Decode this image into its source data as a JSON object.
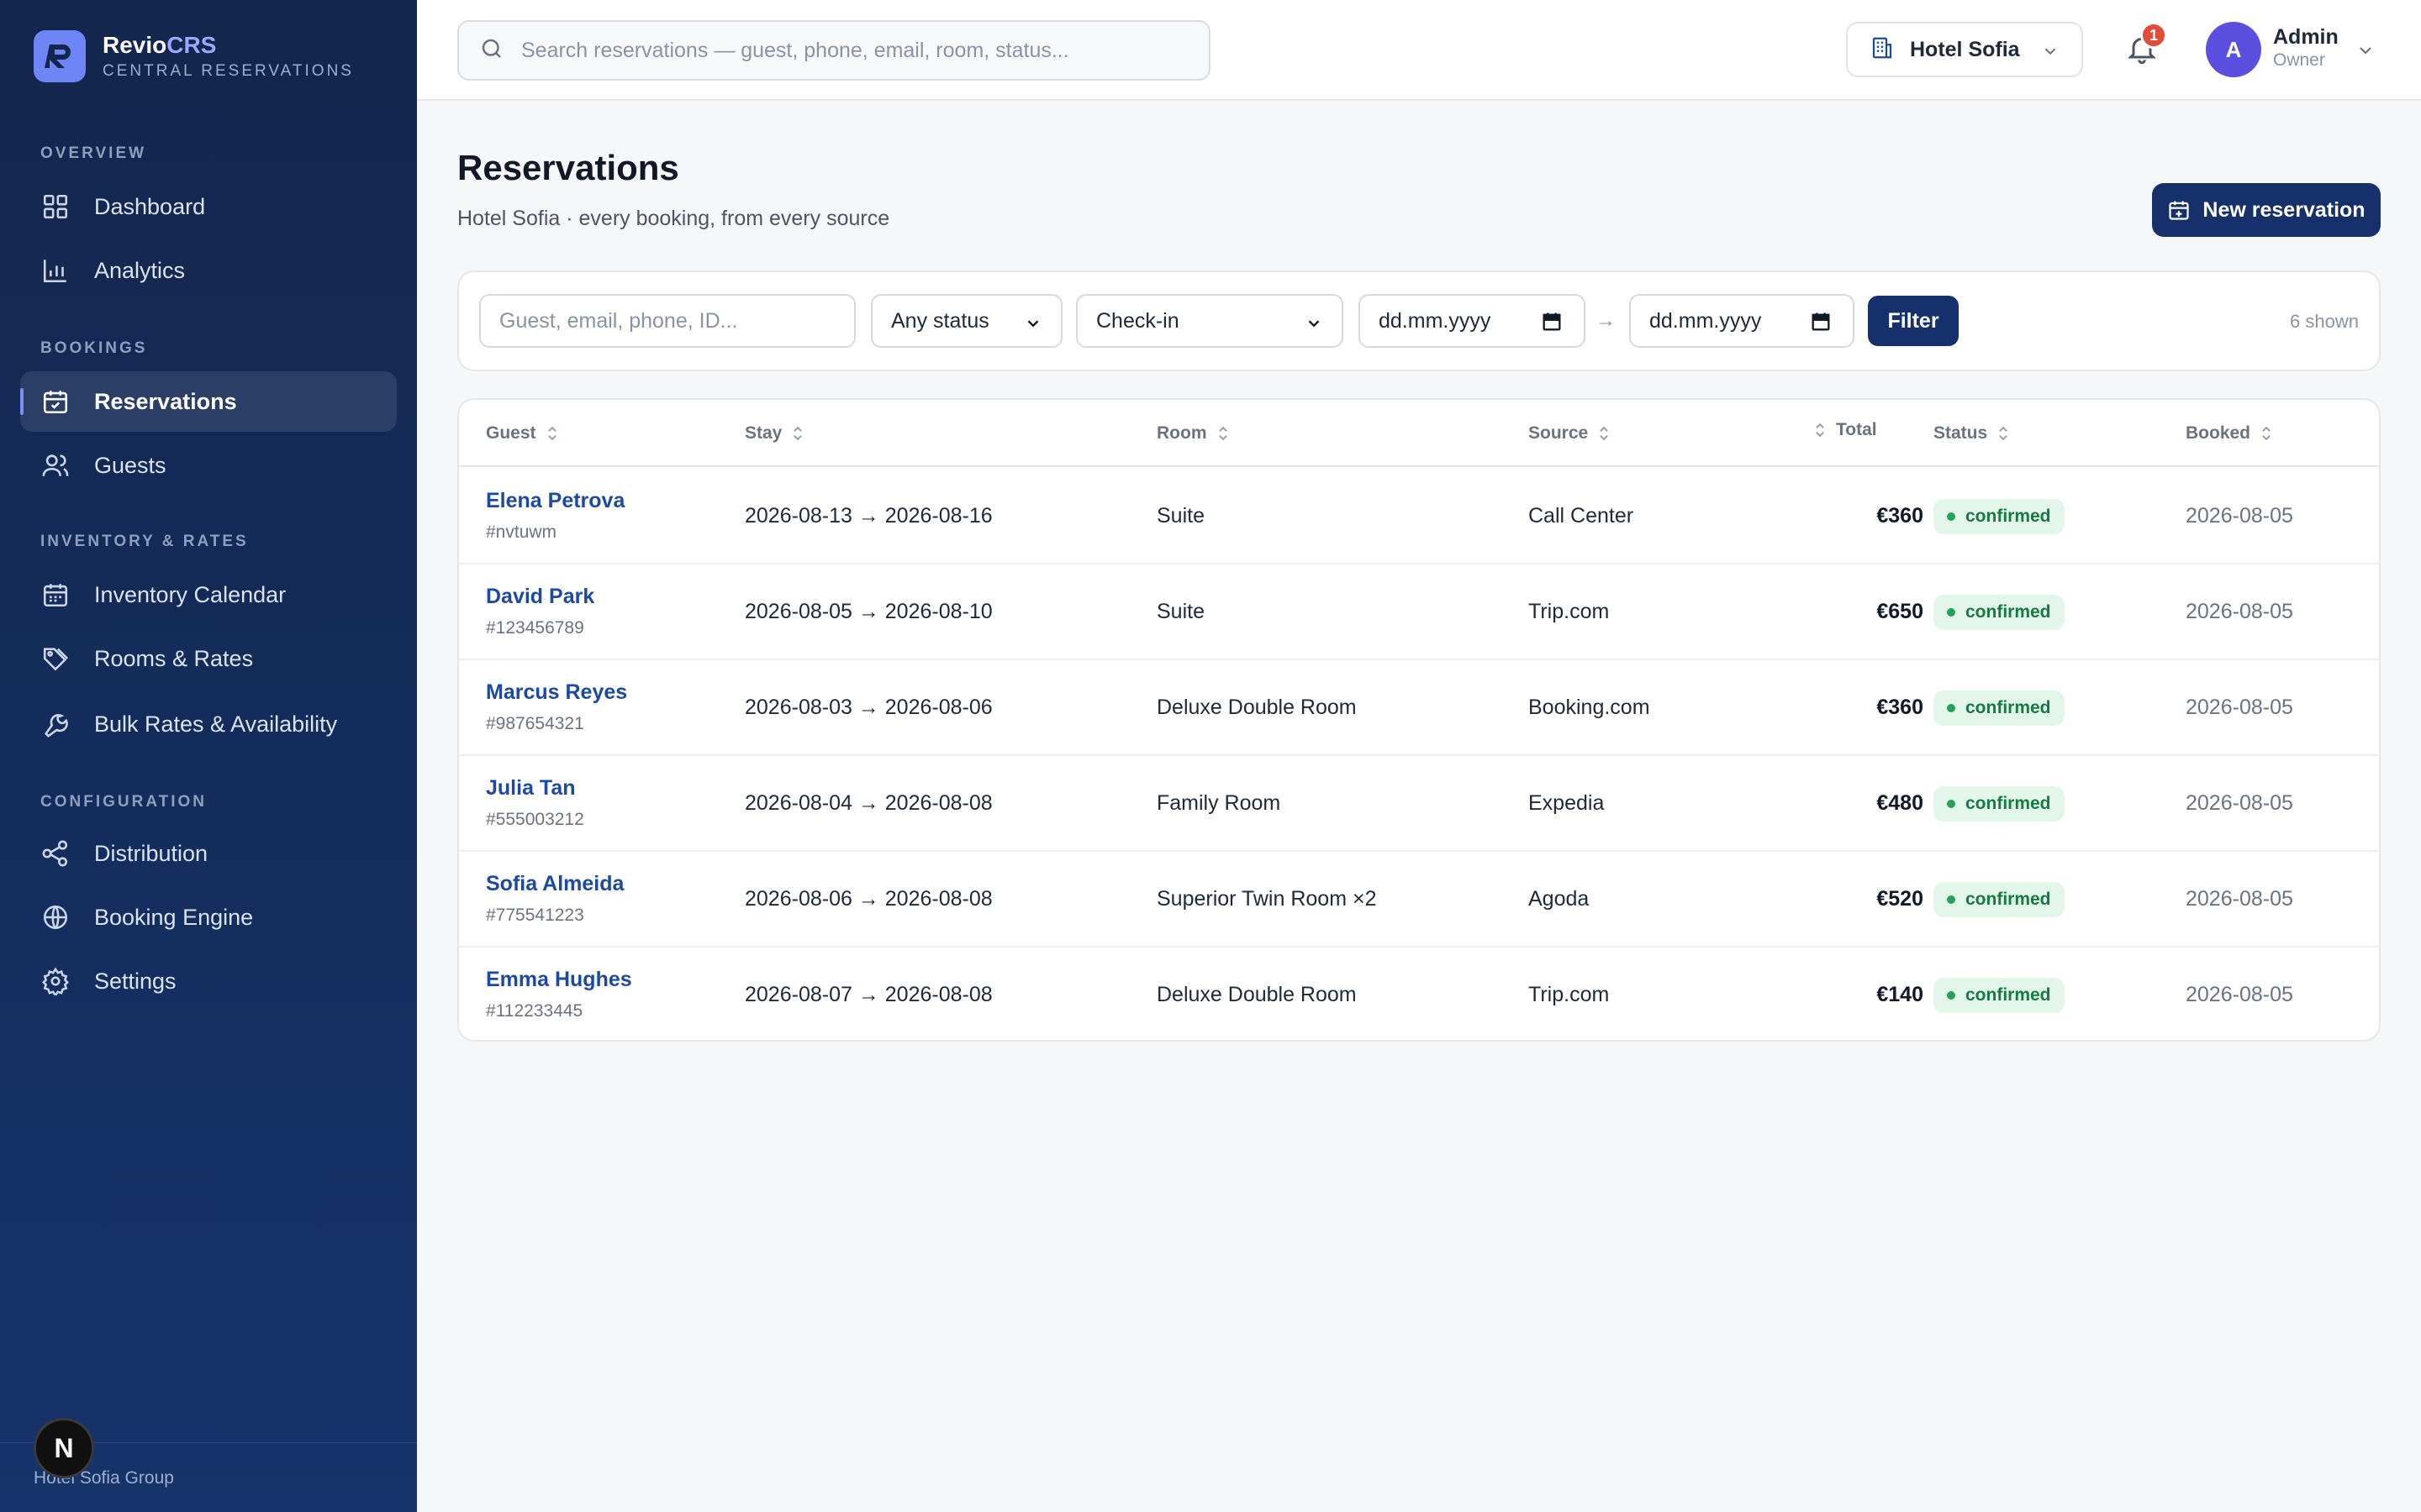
{
  "brand": {
    "name_main": "Revio",
    "name_accent": "CRS",
    "subtitle": "CENTRAL RESERVATIONS"
  },
  "sidebar": {
    "sections": [
      {
        "label": "OVERVIEW",
        "items": [
          {
            "label": "Dashboard",
            "icon": "grid-icon"
          },
          {
            "label": "Analytics",
            "icon": "bar-chart-icon"
          }
        ]
      },
      {
        "label": "BOOKINGS",
        "items": [
          {
            "label": "Reservations",
            "icon": "calendar-check-icon",
            "active": true
          },
          {
            "label": "Guests",
            "icon": "users-icon"
          }
        ]
      },
      {
        "label": "INVENTORY & RATES",
        "items": [
          {
            "label": "Inventory Calendar",
            "icon": "calendar-icon"
          },
          {
            "label": "Rooms & Rates",
            "icon": "tags-icon"
          },
          {
            "label": "Bulk Rates & Availability",
            "icon": "wrench-icon"
          }
        ]
      },
      {
        "label": "CONFIGURATION",
        "items": [
          {
            "label": "Distribution",
            "icon": "share-icon"
          },
          {
            "label": "Booking Engine",
            "icon": "globe-icon"
          },
          {
            "label": "Settings",
            "icon": "gear-icon"
          }
        ]
      }
    ],
    "footer": "Hotel Sofia Group",
    "badge_letter": "N"
  },
  "topbar": {
    "search_placeholder": "Search reservations — guest, phone, email, room, status...",
    "hotel": "Hotel Sofia",
    "notifications": "1",
    "user": {
      "initial": "A",
      "name": "Admin",
      "role": "Owner"
    }
  },
  "page": {
    "title": "Reservations",
    "subtitle": "Hotel Sofia · every booking, from every source",
    "new_button": "New reservation"
  },
  "filters": {
    "search_placeholder": "Guest, email, phone, ID...",
    "status": "Any status",
    "date_type": "Check-in",
    "date_from": "dd.mm.yyyy",
    "date_to": "dd.mm.yyyy",
    "arrow": "→",
    "filter_button": "Filter",
    "shown": "6 shown"
  },
  "table": {
    "columns": {
      "guest": "Guest",
      "stay": "Stay",
      "room": "Room",
      "source": "Source",
      "total": "Total",
      "status": "Status",
      "booked": "Booked"
    },
    "rows": [
      {
        "name": "Elena Petrova",
        "id": "#nvtuwm",
        "stay": "2026-08-13 → 2026-08-16",
        "room": "Suite",
        "source": "Call Center",
        "total": "€360",
        "status": "confirmed",
        "booked": "2026-08-05"
      },
      {
        "name": "David Park",
        "id": "#123456789",
        "stay": "2026-08-05 → 2026-08-10",
        "room": "Suite",
        "source": "Trip.com",
        "total": "€650",
        "status": "confirmed",
        "booked": "2026-08-05"
      },
      {
        "name": "Marcus Reyes",
        "id": "#987654321",
        "stay": "2026-08-03 → 2026-08-06",
        "room": "Deluxe Double Room",
        "source": "Booking.com",
        "total": "€360",
        "status": "confirmed",
        "booked": "2026-08-05"
      },
      {
        "name": "Julia Tan",
        "id": "#555003212",
        "stay": "2026-08-04 → 2026-08-08",
        "room": "Family Room",
        "source": "Expedia",
        "total": "€480",
        "status": "confirmed",
        "booked": "2026-08-05"
      },
      {
        "name": "Sofia Almeida",
        "id": "#775541223",
        "stay": "2026-08-06 → 2026-08-08",
        "room": "Superior Twin Room ×2",
        "source": "Agoda",
        "total": "€520",
        "status": "confirmed",
        "booked": "2026-08-05"
      },
      {
        "name": "Emma Hughes",
        "id": "#112233445",
        "stay": "2026-08-07 → 2026-08-08",
        "room": "Deluxe Double Room",
        "source": "Trip.com",
        "total": "€140",
        "status": "confirmed",
        "booked": "2026-08-05"
      }
    ]
  },
  "colors": {
    "sidebar": "#13264d",
    "primary": "#15306a",
    "link": "#1d4aa0",
    "accent": "#6e86f5",
    "success_bg": "#e3f6ea",
    "success_text": "#177a45"
  }
}
